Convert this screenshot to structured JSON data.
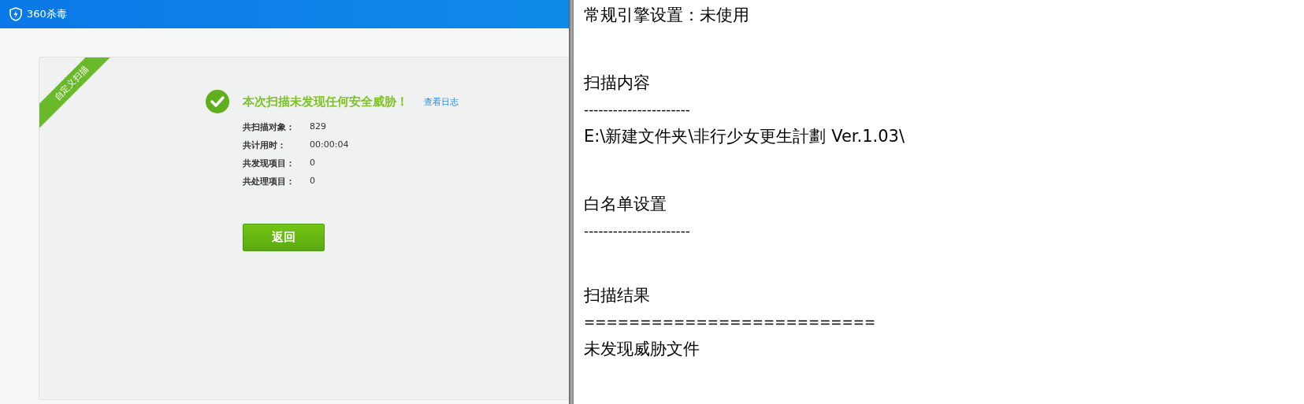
{
  "app_window": {
    "title": "360杀毒",
    "card": {
      "ribbon": "自定义扫描",
      "message": "本次扫描未发现任何安全威胁！",
      "log_link": "查看日志",
      "stats": [
        {
          "label": "共扫描对象：",
          "value": "829"
        },
        {
          "label": "共计用时：",
          "value": "00:00:04"
        },
        {
          "label": "共发现项目：",
          "value": "0"
        },
        {
          "label": "共处理项目：",
          "value": "0"
        }
      ],
      "button": "返回"
    }
  },
  "log_text": {
    "sections": [
      {
        "heading": "常规引擎设置：未使用"
      },
      {
        "heading": "扫描内容",
        "rule": "----------------------",
        "content": "E:\\新建文件夹\\非行少女更生計劃 Ver.1.03\\"
      },
      {
        "heading": "白名单设置",
        "rule": "----------------------"
      },
      {
        "heading": "扫描结果",
        "rule": "==========================",
        "content": "未发现威胁文件"
      }
    ]
  }
}
